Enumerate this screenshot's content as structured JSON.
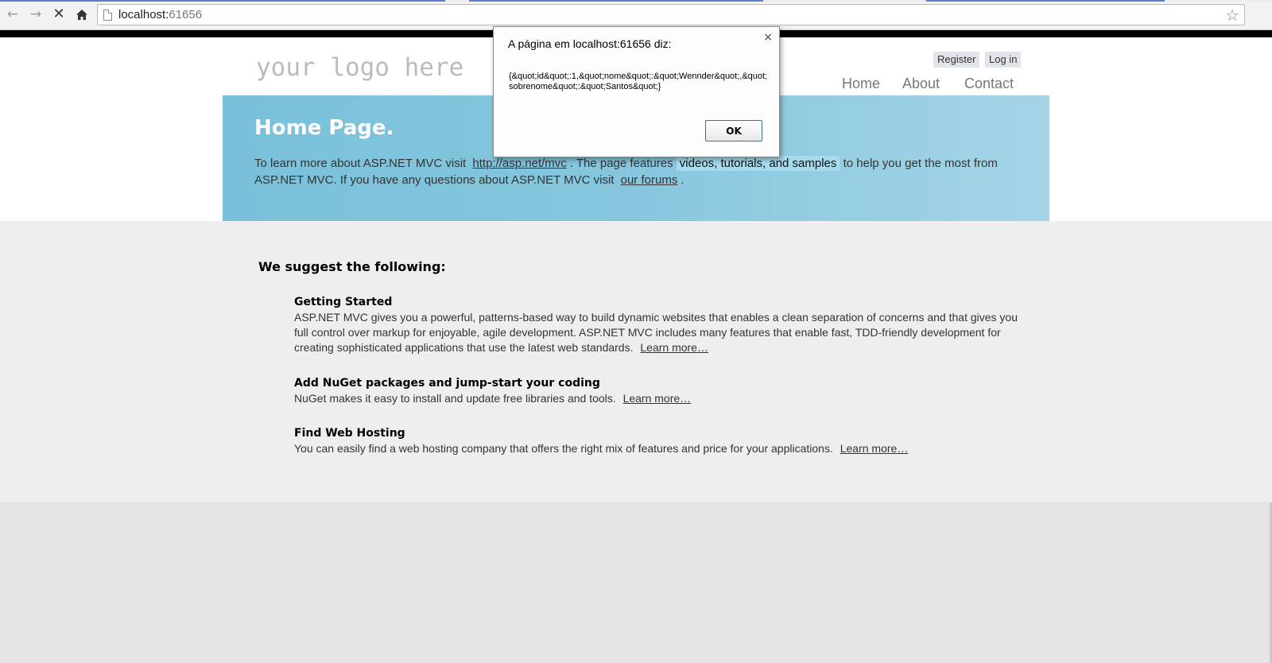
{
  "browser": {
    "url_host": "localhost:",
    "url_port": "61656",
    "back_icon": "back-arrow-icon",
    "forward_icon": "forward-arrow-icon",
    "stop_icon": "stop-icon",
    "home_icon": "home-icon",
    "star_icon": "bookmark-star-icon"
  },
  "header": {
    "logo": "your logo here",
    "register": "Register",
    "login": "Log in",
    "menu": [
      "Home",
      "About",
      "Contact"
    ]
  },
  "featured": {
    "title": "Home Page.",
    "text_1": "To learn more about ASP.NET MVC visit",
    "link_1": "http://asp.net/mvc",
    "text_2": ". The page features",
    "mark": "videos, tutorials, and samples",
    "text_3": "to help you get the most from ASP.NET MVC. If you have any questions about ASP.NET MVC visit",
    "link_2": "our forums",
    "text_4": "."
  },
  "main": {
    "heading": "We suggest the following:",
    "steps": [
      {
        "title": "Getting Started",
        "text": "ASP.NET MVC gives you a powerful, patterns-based way to build dynamic websites that enables a clean separation of concerns and that gives you full control over markup for enjoyable, agile development. ASP.NET MVC includes many features that enable fast, TDD-friendly development for creating sophisticated applications that use the latest web standards.",
        "link": "Learn more…"
      },
      {
        "title": "Add NuGet packages and jump-start your coding",
        "text": "NuGet makes it easy to install and update free libraries and tools.",
        "link": "Learn more…"
      },
      {
        "title": "Find Web Hosting",
        "text": "You can easily find a web hosting company that offers the right mix of features and price for your applications.",
        "link": "Learn more…"
      }
    ]
  },
  "dialog": {
    "title": "A página em localhost:61656 diz:",
    "message": "{&quot;id&quot;:1,&quot;nome&quot;:&quot;Wennder&quot;,&quot;sobrenome&quot;:&quot;Santos&quot;}",
    "ok": "OK",
    "close": "×"
  },
  "colors": {
    "featured_blue": "#7ac0da",
    "dialog_button_border": "#3a6ea5"
  }
}
